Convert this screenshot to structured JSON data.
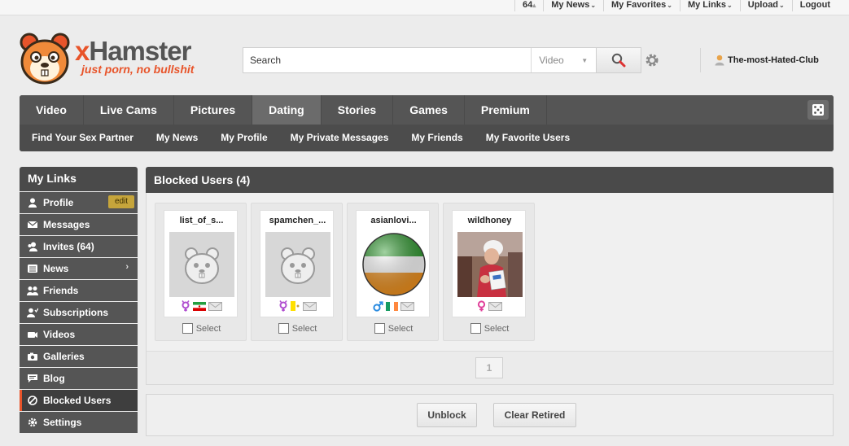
{
  "topbar": {
    "count": "64",
    "links": [
      {
        "label": "My News",
        "caret": true
      },
      {
        "label": "My Favorites",
        "caret": true
      },
      {
        "label": "My Links",
        "caret": true
      },
      {
        "label": "Upload",
        "caret": true
      },
      {
        "label": "Logout",
        "caret": false
      }
    ]
  },
  "header": {
    "brand_x": "x",
    "brand_rest": "Hamster",
    "tagline": "just porn, no bullshit",
    "search_placeholder": "Search",
    "search_type": "Video",
    "username": "The-most-Hated-Club"
  },
  "nav": {
    "primary": [
      "Video",
      "Live Cams",
      "Pictures",
      "Dating",
      "Stories",
      "Games",
      "Premium"
    ],
    "active_primary": "Dating",
    "secondary": [
      "Find Your Sex Partner",
      "My News",
      "My Profile",
      "My Private Messages",
      "My Friends",
      "My Favorite Users"
    ]
  },
  "sidebar": {
    "title": "My Links",
    "items": [
      {
        "label": "Profile",
        "icon": "user-icon",
        "badge": "edit"
      },
      {
        "label": "Messages",
        "icon": "envelope-icon"
      },
      {
        "label": "Invites (64)",
        "icon": "users-icon"
      },
      {
        "label": "News",
        "icon": "news-icon",
        "arrow": "›"
      },
      {
        "label": "Friends",
        "icon": "friends-icon"
      },
      {
        "label": "Subscriptions",
        "icon": "subscriptions-icon"
      },
      {
        "label": "Videos",
        "icon": "video-camera-icon"
      },
      {
        "label": "Galleries",
        "icon": "camera-icon"
      },
      {
        "label": "Blog",
        "icon": "blog-icon"
      },
      {
        "label": "Blocked Users",
        "icon": "blocked-icon",
        "active": true
      },
      {
        "label": "Settings",
        "icon": "settings-icon"
      }
    ]
  },
  "content": {
    "title": "Blocked Users (4)",
    "select_label": "Select",
    "page": "1",
    "users": [
      {
        "name": "list_of_s...",
        "avatar": "placeholder",
        "gender": "trans",
        "flag": "iran"
      },
      {
        "name": "spamchen_...",
        "avatar": "placeholder",
        "gender": "trans",
        "flag": "vatican"
      },
      {
        "name": "asianlovi...",
        "avatar": "ball",
        "gender": "male",
        "flag": "ireland"
      },
      {
        "name": "wildhoney",
        "avatar": "photo",
        "gender": "female",
        "flag": ""
      }
    ]
  },
  "actions": {
    "unblock": "Unblock",
    "clear_retired": "Clear Retired"
  },
  "colors": {
    "accent": "#e8542a",
    "nav_dark": "#4a4a4a",
    "trans": "#b04ed0",
    "male": "#2a8be0",
    "female": "#e0409a"
  }
}
